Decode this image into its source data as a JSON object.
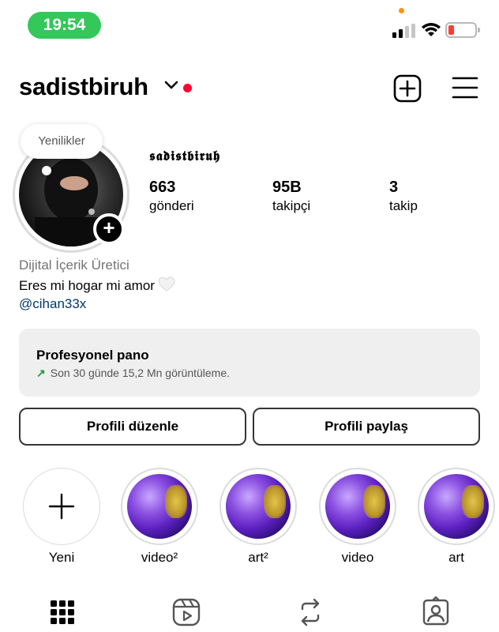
{
  "status_bar": {
    "time": "19:54"
  },
  "header": {
    "username": "sadistbiruh"
  },
  "profile": {
    "new_bubble": "Yenilikler",
    "display_name": "𝖘𝖆𝖉𝖎𝖘𝖙𝖇𝖎𝖗𝖚𝖍",
    "stats": [
      {
        "value": "663",
        "label": "gönderi"
      },
      {
        "value": "95B",
        "label": "takipçi"
      },
      {
        "value": "3",
        "label": "takip"
      }
    ],
    "category": "Dijital İçerik Üretici",
    "bio": "Eres mi hogar mi amor",
    "link": "@cihan33x"
  },
  "dashboard": {
    "title": "Profesyonel pano",
    "subtitle": "Son 30 günde 15,2 Mn görüntüleme."
  },
  "buttons": {
    "edit": "Profili düzenle",
    "share": "Profili paylaş"
  },
  "highlights": [
    {
      "label": "Yeni"
    },
    {
      "label": "video²"
    },
    {
      "label": "art²"
    },
    {
      "label": "video"
    },
    {
      "label": "art"
    }
  ],
  "icons": {
    "tabs": [
      "grid-icon",
      "reels-icon",
      "reposts-icon",
      "tagged-icon"
    ]
  }
}
